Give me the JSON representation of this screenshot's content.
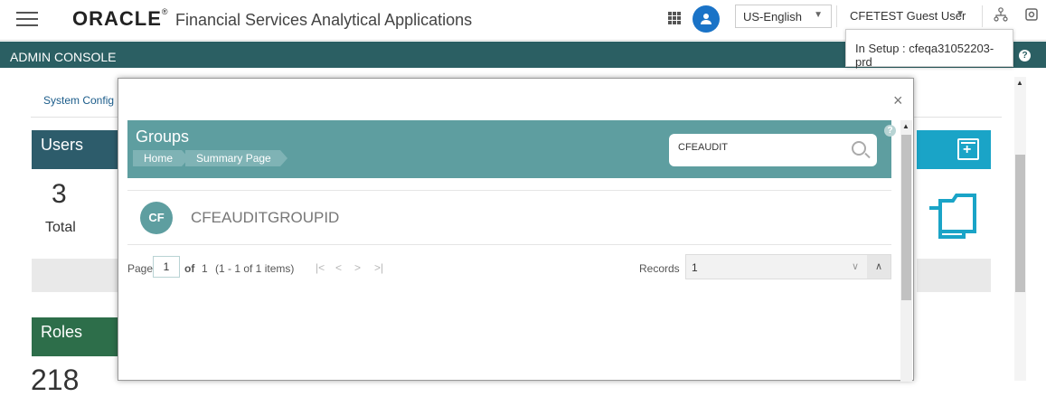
{
  "header": {
    "brand": "ORACLE",
    "brand_reg": "®",
    "app_title": "Financial Services Analytical Applications",
    "language": "US-English",
    "user_label": "CFETEST Guest User",
    "setup_tooltip": "In Setup : cfeqa31052203-prd"
  },
  "adminbar": {
    "title": "ADMIN CONSOLE",
    "help": "?"
  },
  "background": {
    "system_config": "System Config",
    "users_card": {
      "title": "Users",
      "count": "3",
      "label": "Total"
    },
    "roles_card": {
      "title": "Roles",
      "count": "218"
    }
  },
  "modal": {
    "close": "×",
    "groups_title": "Groups",
    "breadcrumbs": [
      "Home",
      "Summary Page"
    ],
    "search_value": "CFEAUDIT",
    "help": "?",
    "row": {
      "avatar": "CF",
      "group_id": "CFEAUDITGROUPID"
    },
    "pager": {
      "page_label": "Page",
      "page_value": "1",
      "of_label": "of",
      "total_pages": "1",
      "items": "(1 - 1 of 1 items)",
      "records_label": "Records",
      "records_value": "1"
    }
  },
  "colors": {
    "admin_bar": "#2b5f63",
    "groups_header": "#5e9ea0",
    "users_card": "#2d5c6b",
    "roles_card": "#2d6e4a",
    "accent_teal": "#1aa4c7"
  }
}
